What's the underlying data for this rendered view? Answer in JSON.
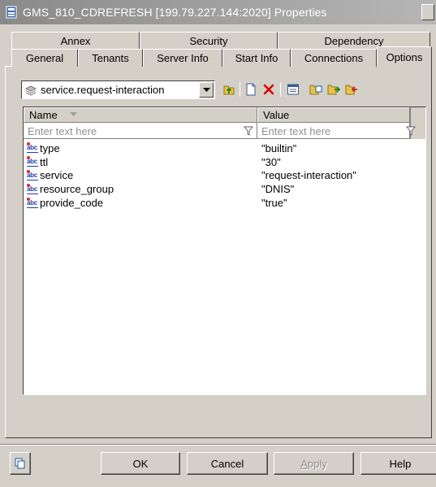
{
  "window": {
    "title": "GMS_810_CDREFRESH [199.79.227.144:2020] Properties"
  },
  "tabs": {
    "row1": [
      {
        "label": "Annex"
      },
      {
        "label": "Security"
      },
      {
        "label": "Dependency"
      }
    ],
    "row2": [
      {
        "label": "General"
      },
      {
        "label": "Tenants"
      },
      {
        "label": "Server Info"
      },
      {
        "label": "Start Info"
      },
      {
        "label": "Connections"
      },
      {
        "label": "Options"
      }
    ],
    "active": "Options"
  },
  "section_selector": {
    "value": "service.request-interaction"
  },
  "toolbar": {
    "icons": [
      "up-folder-icon",
      "new-icon",
      "delete-icon",
      "properties-icon",
      "copy-icon",
      "import-icon",
      "export-icon"
    ]
  },
  "grid": {
    "columns": [
      {
        "label": "Name"
      },
      {
        "label": "Value"
      }
    ],
    "filter_placeholder": "Enter text here",
    "rows": [
      {
        "name": "type",
        "value": "\"builtin\""
      },
      {
        "name": "ttl",
        "value": "\"30\""
      },
      {
        "name": "service",
        "value": "\"request-interaction\""
      },
      {
        "name": "resource_group",
        "value": "\"DNIS\""
      },
      {
        "name": "provide_code",
        "value": "\"true\""
      }
    ]
  },
  "buttons": {
    "ok": "OK",
    "cancel": "Cancel",
    "apply_first": "A",
    "apply_rest": "pply",
    "help": "Help"
  },
  "colors": {
    "face": "#d4d0c8",
    "title_start": "#8a8a8a",
    "delete_red": "#e00000",
    "abc_blue": "#1f3fa6"
  }
}
